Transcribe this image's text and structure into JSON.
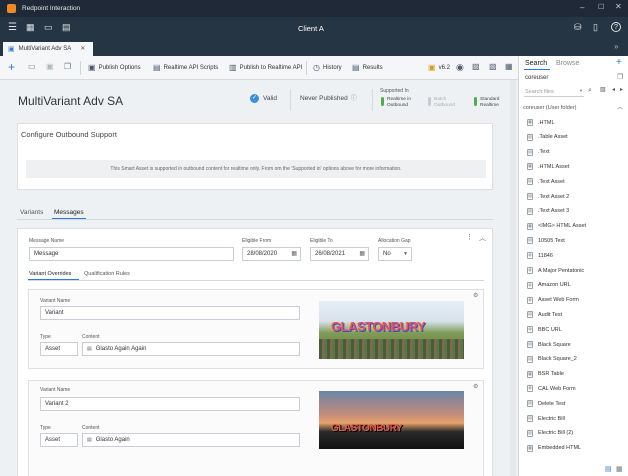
{
  "window": {
    "title": "Redpoint Interaction",
    "client": "Client A"
  },
  "tab": {
    "label": "MultiVariant Adv SA"
  },
  "toolbar": {
    "publish_options": "Publish Options",
    "realtime_api_scripts": "Realtime API Scripts",
    "publish_to_realtime_api": "Publish to Realtime API",
    "history": "History",
    "results": "Results",
    "version": "v6.2"
  },
  "header": {
    "title": "MultiVariant Adv SA",
    "valid": "Valid",
    "never_published": "Never Published",
    "supported_in": "Supported In",
    "realtime_outbound": "Realtime in Outbound",
    "batch_outbound": "Batch Outbound",
    "standard_realtime": "Standard Realtime"
  },
  "configure": {
    "title": "Configure Outbound Support",
    "notice": "This Smart Asset is supported in outbound content for realtime only. From om the 'Supported in' options above for more information."
  },
  "tabs": {
    "variants": "Variants",
    "messages": "Messages"
  },
  "message": {
    "name_label": "Message Name",
    "name_value": "Message",
    "eligible_from_label": "Eligible From",
    "eligible_from": "28/08/2020",
    "eligible_to_label": "Eligible To",
    "eligible_to": "26/08/2021",
    "allocation_label": "Allocation Gap",
    "allocation_value": "No"
  },
  "subtabs": {
    "overrides": "Variant Overrides",
    "qualification": "Qualification Rules"
  },
  "variants": [
    {
      "name_label": "Variant Name",
      "name": "Variant",
      "type_label": "Type",
      "type": "Asset",
      "content_label": "Content",
      "content": "Glasto Again Again",
      "image_text": "GLASTONBURY"
    },
    {
      "name_label": "Variant Name",
      "name": "Variant 2",
      "type_label": "Type",
      "type": "Asset",
      "content_label": "Content",
      "content": "Glasto Again",
      "image_text": "GLASTONBURY"
    }
  ],
  "right": {
    "tab_search": "Search",
    "tab_browse": "Browse",
    "user": "coreuser",
    "search_placeholder": "Search files",
    "folder": "coreuser (User folder)",
    "items": [
      ".HTML",
      ".Table Asset",
      ".Text",
      ".HTML Asset",
      ".Text Asset",
      ".Text Asset 2",
      ".Text Asset 3",
      "<IMG> HTML Asset",
      "10505 Text",
      "11846",
      "A Major Pentatonic",
      "Amazon URL",
      "Asset Web Form",
      "Audit Test",
      "BBC URL",
      "Black Square",
      "Black Square_2",
      "BSR Table",
      "CAL Web Form",
      "Delete Test",
      "Electric Bill",
      "Electric Bill (2)",
      "Embedded HTML"
    ]
  }
}
